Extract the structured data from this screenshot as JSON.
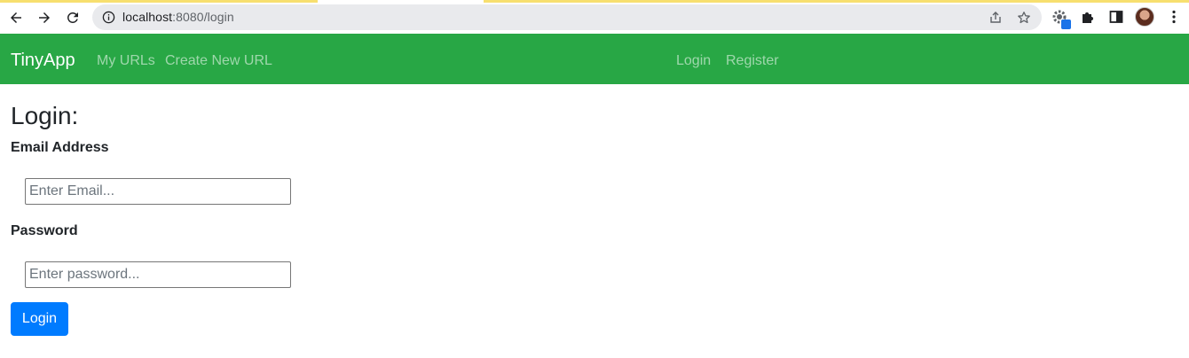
{
  "browser": {
    "url_host": "localhost",
    "url_path": ":8080/login"
  },
  "navbar": {
    "brand": "TinyApp",
    "left_links": [
      "My URLs",
      "Create New URL"
    ],
    "right_links": [
      "Login",
      "Register"
    ],
    "background": "#28a745"
  },
  "page": {
    "title": "Login:"
  },
  "form": {
    "email_label": "Email Address",
    "email_placeholder": "Enter Email...",
    "email_value": "",
    "password_label": "Password",
    "password_placeholder": "Enter password...",
    "password_value": "",
    "submit_label": "Login",
    "submit_color": "#007bff"
  }
}
